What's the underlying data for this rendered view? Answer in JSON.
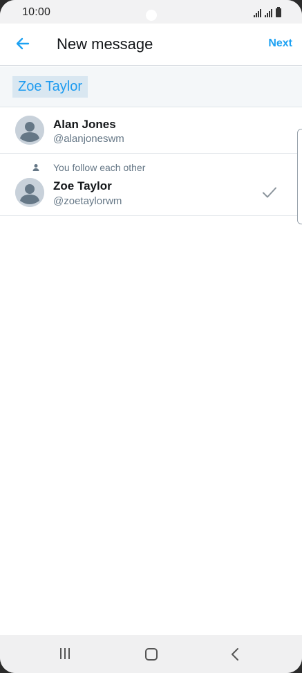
{
  "status_bar": {
    "time": "10:00"
  },
  "app_bar": {
    "title": "New message",
    "next_label": "Next"
  },
  "recipient": {
    "chip_label": "Zoe Taylor"
  },
  "results": [
    {
      "name": "Alan Jones",
      "handle": "@alanjoneswm",
      "selected": false
    },
    {
      "relationship": "You follow each other",
      "name": "Zoe Taylor",
      "handle": "@zoetaylorwm",
      "selected": true
    }
  ],
  "icons": {
    "back": "arrow-left-icon",
    "avatar": "default-avatar-icon",
    "follow": "person-icon",
    "check": "checkmark-icon"
  },
  "colors": {
    "accent": "#1da1f2",
    "chip_bg": "#d9e7f1",
    "muted_text": "#657786"
  }
}
